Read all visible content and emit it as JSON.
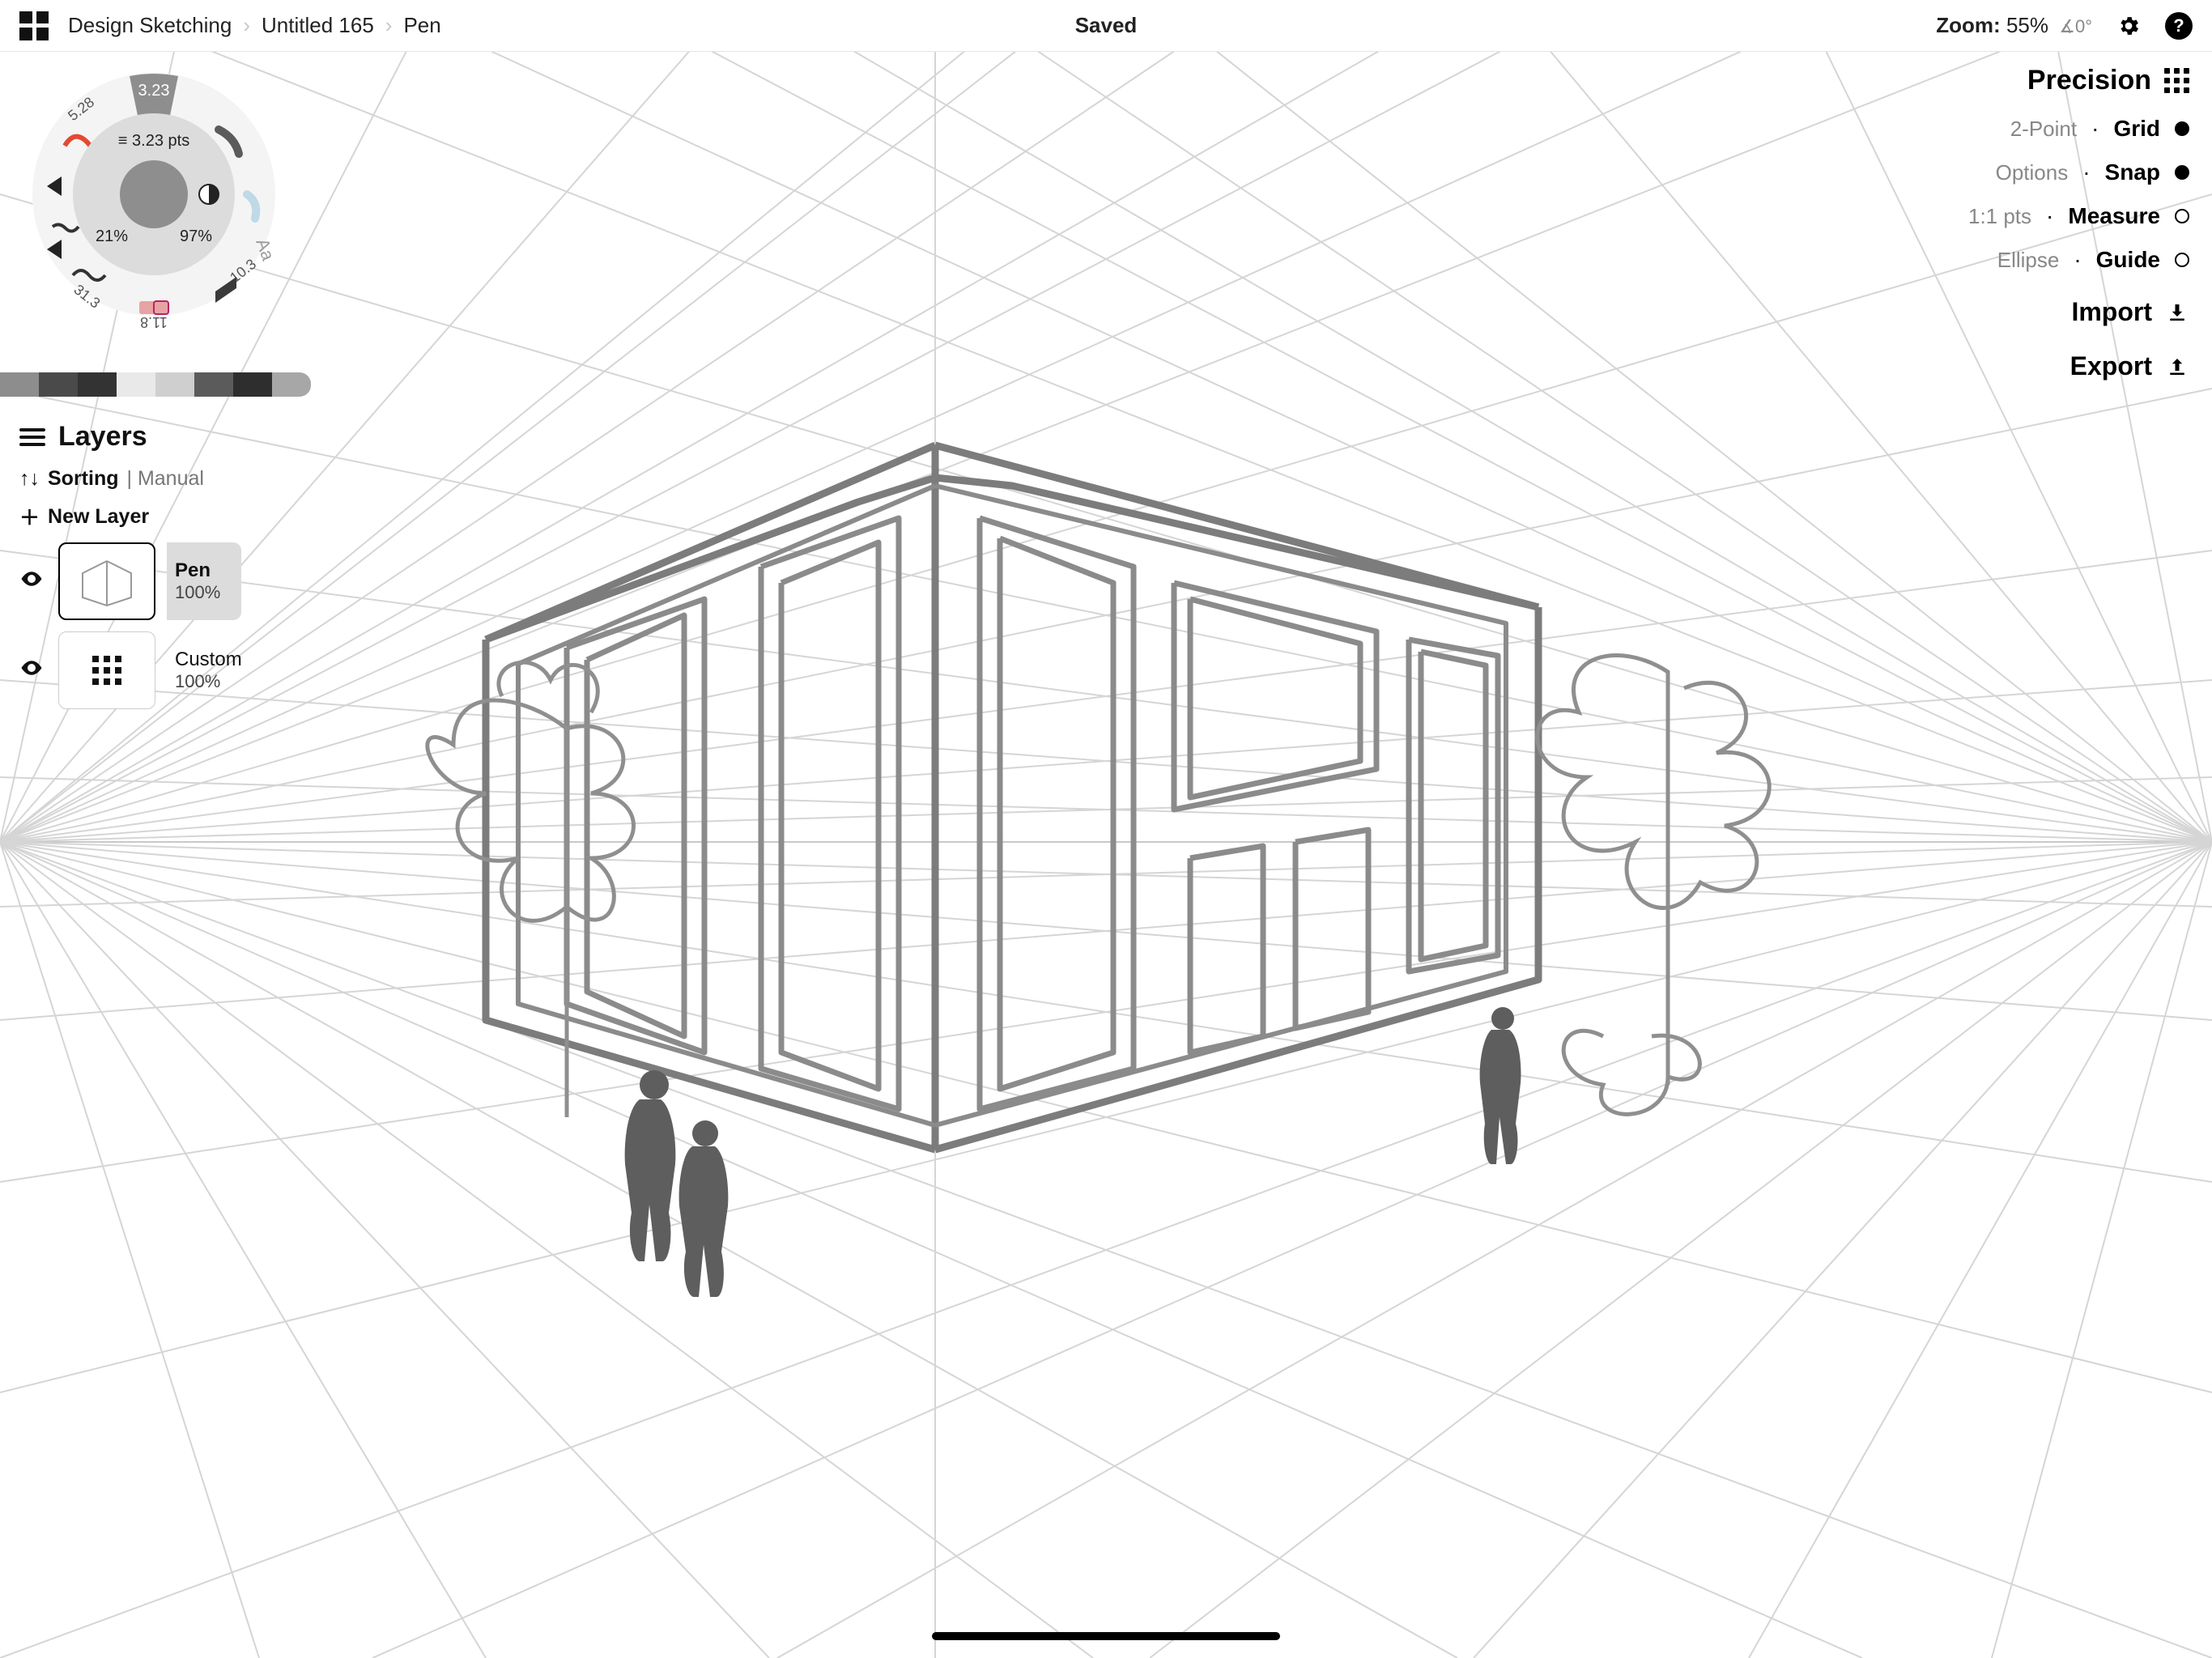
{
  "breadcrumbs": {
    "root": "Design Sketching",
    "doc": "Untitled 165",
    "tool": "Pen"
  },
  "status": "Saved",
  "zoom": {
    "label": "Zoom:",
    "pct": "55%",
    "angle": "0°"
  },
  "toolwheel": {
    "active_size": "3.23",
    "size_label": "3.23 pts",
    "opacity_left": "21%",
    "opacity_right": "97%",
    "presets": {
      "nw": "5.28",
      "se": "10.3",
      "sw": "31.3",
      "s": "11.8"
    }
  },
  "swatches": [
    "#8d8d8d",
    "#4a4a4a",
    "#333333",
    "#e9e9e9",
    "#cfcfcf",
    "#5b5b5b",
    "#2e2e2e",
    "#a7a7a7"
  ],
  "layers": {
    "title": "Layers",
    "sorting_label": "Sorting",
    "sorting_mode": "Manual",
    "new_layer": "New Layer",
    "items": [
      {
        "name": "Pen",
        "opacity": "100%",
        "kind": "sketch",
        "selected": true
      },
      {
        "name": "Custom",
        "opacity": "100%",
        "kind": "grid",
        "selected": false
      }
    ]
  },
  "precision": {
    "title": "Precision",
    "rows": [
      {
        "sub": "2-Point",
        "label": "Grid",
        "state": "on"
      },
      {
        "sub": "Options",
        "label": "Snap",
        "state": "on"
      },
      {
        "sub": "1:1 pts",
        "label": "Measure",
        "state": "off"
      },
      {
        "sub": "Ellipse",
        "label": "Guide",
        "state": "off"
      }
    ],
    "import": "Import",
    "export": "Export"
  }
}
